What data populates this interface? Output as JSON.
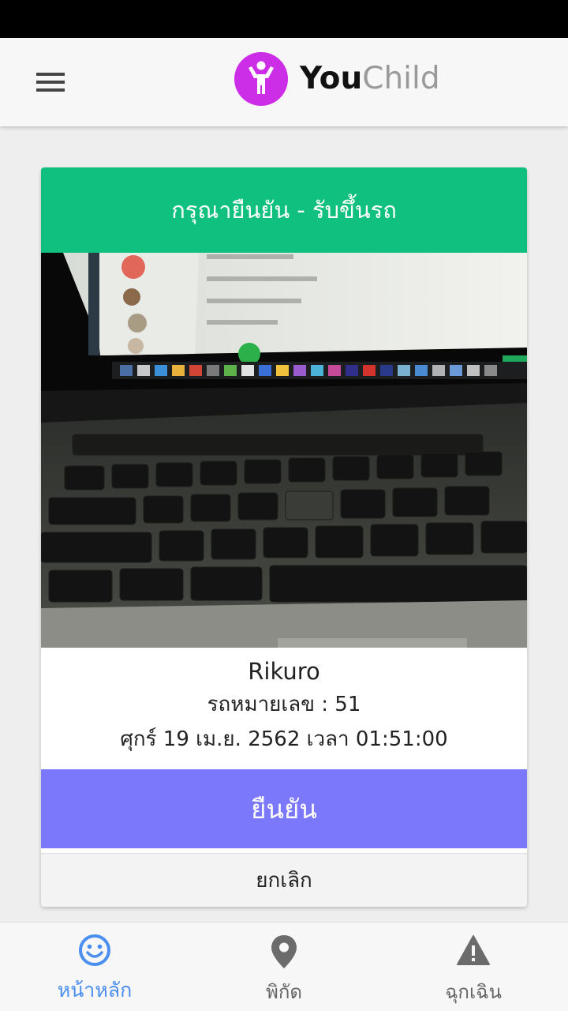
{
  "app": {
    "brand_bold": "You",
    "brand_light": "Child"
  },
  "dialog": {
    "title": "กรุณายืนยัน - รับขึ้นรถ",
    "name": "Rikuro",
    "vehicle_line": "รถหมายเลข : 51",
    "datetime_line": "ศุกร์ 19 เม.ย. 2562 เวลา 01:51:00",
    "confirm_label": "ยืนยัน",
    "cancel_label": "ยกเลิก"
  },
  "bottom_nav": {
    "items": [
      {
        "label": "หน้าหลัก",
        "icon": "smile-icon",
        "active": true
      },
      {
        "label": "พิกัด",
        "icon": "location-pin-icon",
        "active": false
      },
      {
        "label": "ฉุกเฉิน",
        "icon": "warning-icon",
        "active": false
      }
    ]
  },
  "colors": {
    "header_green": "#0fc07e",
    "confirm_purple": "#7b78fc",
    "logo_magenta": "#cc2de6",
    "nav_active_blue": "#4a8ff0"
  }
}
